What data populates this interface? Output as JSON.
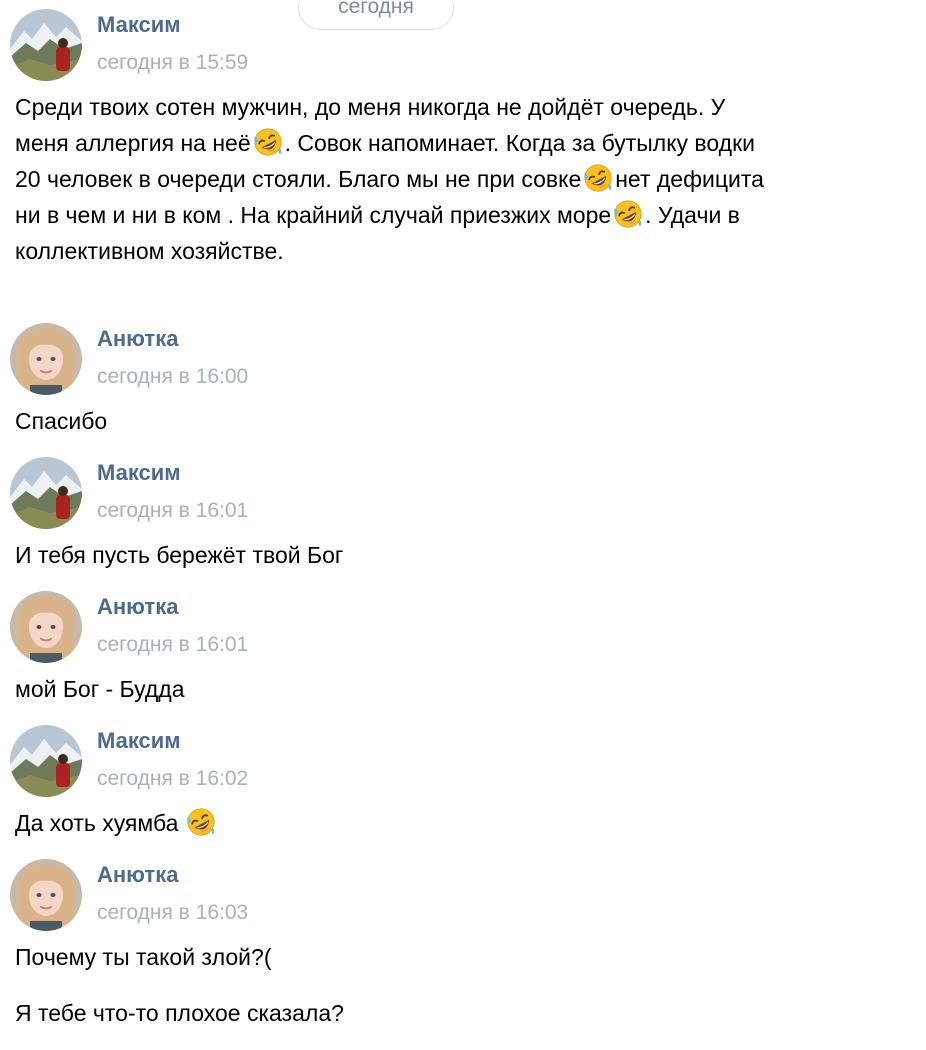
{
  "date_divider": "сегодня",
  "messages": [
    {
      "author": "Максим",
      "avatar": "maksim-avatar",
      "time": "сегодня в 15:59",
      "segments": [
        "Среди твоих сотен мужчин, до меня никогда не дойдёт очередь. У меня аллергия на неё",
        ". Совок напоминает. Когда за бутылку водки 20 человек в очереди стояли. Благо мы не при совке",
        "нет дефицита ни в чем и ни в ком . На крайний случай приезжих море",
        ". Удачи в коллективном хозяйстве."
      ],
      "emoji": "rofl-emoji"
    },
    {
      "author": "Анютка",
      "avatar": "anyutka-avatar",
      "time": "сегодня в 16:00",
      "text": "Спасибо"
    },
    {
      "author": "Максим",
      "avatar": "maksim-avatar",
      "time": "сегодня в 16:01",
      "text": "И тебя пусть бережёт твой Бог"
    },
    {
      "author": "Анютка",
      "avatar": "anyutka-avatar",
      "time": "сегодня в 16:01",
      "text": "мой Бог - Будда"
    },
    {
      "author": "Максим",
      "avatar": "maksim-avatar",
      "time": "сегодня в 16:02",
      "text": "Да хоть хуямба",
      "emoji": "rofl-emoji"
    },
    {
      "author": "Анютка",
      "avatar": "anyutka-avatar",
      "time": "сегодня в 16:03",
      "lines": [
        "Почему ты такой злой?(",
        "Я тебе что-то плохое сказала?"
      ]
    }
  ],
  "colors": {
    "author": "#4d6b91",
    "time": "#a8b2bd",
    "text": "#000000",
    "pill_border": "#dfe3e8",
    "pill_text": "#818c99"
  }
}
